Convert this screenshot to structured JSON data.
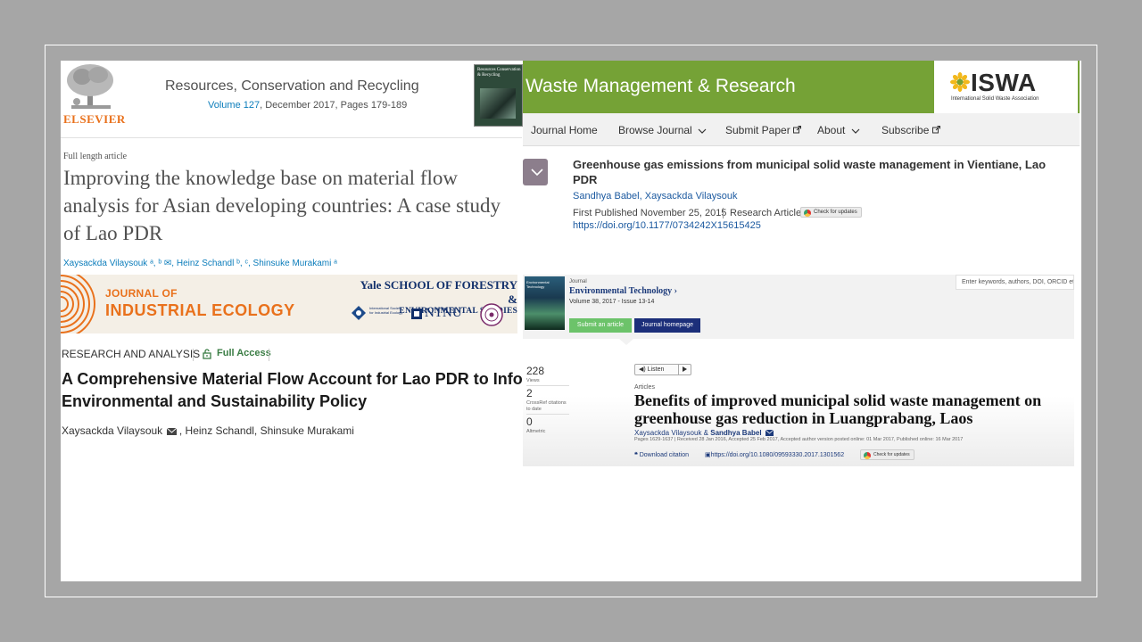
{
  "elsevier": {
    "publisher": "ELSEVIER",
    "journal": "Resources, Conservation and Recycling",
    "volume_link": "Volume 127",
    "volume_rest": ", December 2017, Pages 179-189",
    "cover_title": "Resources Conservation & Recycling",
    "article_type": "Full length article",
    "title": "Improving the knowledge base on material flow analysis for Asian developing countries: A case study of Lao PDR",
    "authors": "Xaysackda Vilaysouk ᵃ, ᵇ ✉, Heinz Schandl ᵇ, ᶜ, Shinsuke Murakami ᵃ"
  },
  "jie": {
    "banner_line1": "JOURNAL OF",
    "banner_line2": "INDUSTRIAL ECOLOGY",
    "yale_line1": "Yale SCHOOL OF FORESTRY &",
    "yale_line2": "ENVIRONMENTAL STUDIES",
    "isie_text": "International Society for Industrial Ecology",
    "ntnu": "NTNU",
    "section": "RESEARCH AND ANALYSIS",
    "access": "Full Access",
    "title_line1": "A Comprehensive Material Flow Account for Lao PDR to Info",
    "title_line2": "Environmental and Sustainability Policy",
    "author1": "Xaysackda Vilaysouk",
    "author2": ",  Heinz Schandl,  Shinsuke Murakami"
  },
  "wmr": {
    "journal": "Waste Management & Research",
    "isw_word": "ISWA",
    "isw_sub": "International Solid Waste Association",
    "nav": [
      "Journal Home",
      "Browse Journal",
      "Submit Paper",
      "About",
      "Subscribe"
    ],
    "title": "Greenhouse gas emissions from municipal solid waste management in Vientiane, Lao PDR",
    "authors": "Sandhya Babel, Xaysackda Vilaysouk",
    "published": "First Published November 25, 2015",
    "type": "Research Article",
    "check": "Check for updates",
    "doi": "https://doi.org/10.1177/0734242X15615425"
  },
  "envtech": {
    "cover_title": "Environmental Technology",
    "journal_label": "Journal",
    "journal": "Environmental Technology",
    "volume": "Volume 38, 2017 - Issue 13-14",
    "btn_submit": "Submit an article",
    "btn_home": "Journal homepage",
    "search_placeholder": "Enter keywords, authors, DOI, ORCID etc",
    "views": "228",
    "views_label": "Views",
    "crossref": "2",
    "crossref_label": "CrossRef citations to date",
    "altmetric": "0",
    "altmetric_label": "Altmetric",
    "listen": "Listen",
    "section": "Articles",
    "title": "Benefits of improved municipal solid waste management on greenhouse gas reduction in Luangprabang, Laos",
    "authors_a": "Xaysackda Vilaysouk & ",
    "authors_b": "Sandhya Babel",
    "dates": "Pages 1629-1637 | Received 28 Jan 2016, Accepted 25 Feb 2017, Accepted author version posted online: 01 Mar 2017, Published online: 16 Mar 2017",
    "download": "Download citation",
    "doi": "https://doi.org/10.1080/09593330.2017.1301562",
    "check": "Check for updates"
  }
}
